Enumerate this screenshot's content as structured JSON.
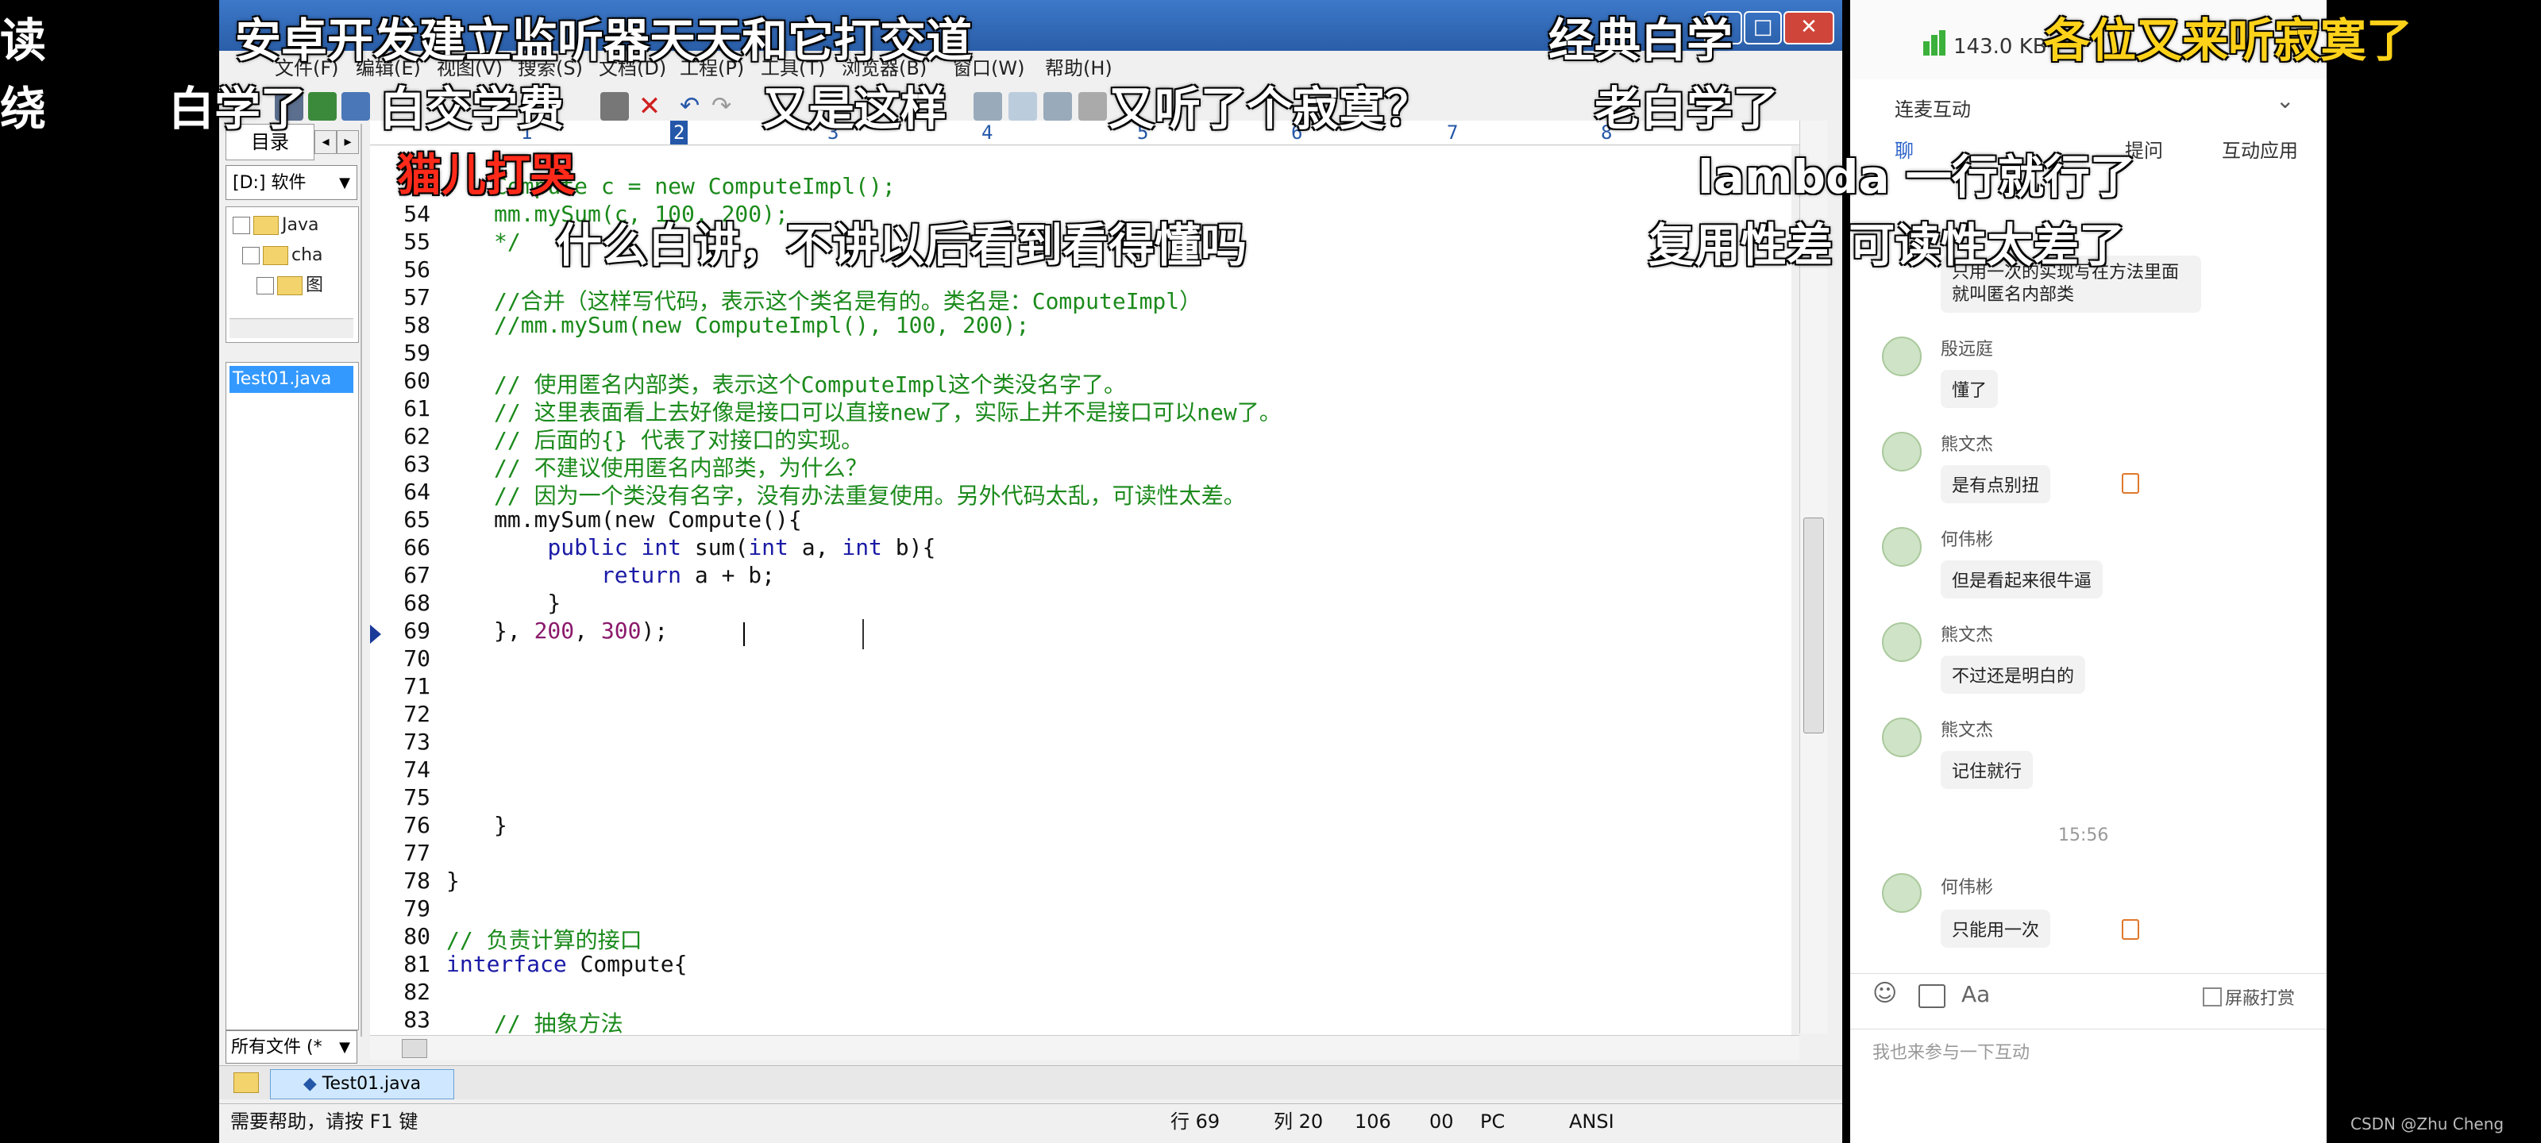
{
  "editor": {
    "menu": [
      "文件(F)",
      "编辑(E)",
      "视图(V)",
      "搜索(S)",
      "文档(D)",
      "工程(P)",
      "工具(T)",
      "浏览器(B)",
      "窗口(W)",
      "帮助(H)"
    ],
    "left_pane": {
      "tab": "目录",
      "drive": "[D:] 软件",
      "tree": [
        "Java",
        "cha",
        "图"
      ],
      "selected_file": "Test01.java",
      "filter": "所有文件 (*"
    },
    "ruler": [
      "1",
      "2",
      "3",
      "4",
      "5",
      "6",
      "7",
      "8"
    ],
    "code_lines": [
      {
        "n": "",
        "t": "Compute c = new ComputeImpl();",
        "c": "cm"
      },
      {
        "n": "54",
        "t": "mm.mySum(c, 100, 200);",
        "c": "cm"
      },
      {
        "n": "55",
        "t": "*/",
        "c": "cm"
      },
      {
        "n": "56",
        "t": "",
        "c": "pl"
      },
      {
        "n": "57",
        "t": "//合并（这样写代码，表示这个类名是有的。类名是：ComputeImpl）",
        "c": "cm"
      },
      {
        "n": "58",
        "t": "//mm.mySum(new ComputeImpl(), 100, 200);",
        "c": "cm"
      },
      {
        "n": "59",
        "t": "",
        "c": "pl"
      },
      {
        "n": "60",
        "t": "// 使用匿名内部类，表示这个ComputeImpl这个类没名字了。",
        "c": "cm"
      },
      {
        "n": "61",
        "t": "// 这里表面看上去好像是接口可以直接new了，实际上并不是接口可以new了。",
        "c": "cm"
      },
      {
        "n": "62",
        "t": "// 后面的{} 代表了对接口的实现。",
        "c": "cm"
      },
      {
        "n": "63",
        "t": "// 不建议使用匿名内部类，为什么？",
        "c": "cm"
      },
      {
        "n": "64",
        "t": "// 因为一个类没有名字，没有办法重复使用。另外代码太乱，可读性太差。",
        "c": "cm"
      },
      {
        "n": "65",
        "t": "mm.mySum(new Compute(){",
        "c": "pl"
      },
      {
        "n": "66",
        "t": "    public int sum(int a, int b){",
        "c": "kwline"
      },
      {
        "n": "67",
        "t": "        return a + b;",
        "c": "retline"
      },
      {
        "n": "68",
        "t": "    }",
        "c": "pl"
      },
      {
        "n": "69",
        "t": "}, 200, 300);",
        "c": "numline"
      },
      {
        "n": "70",
        "t": "",
        "c": "pl"
      },
      {
        "n": "71",
        "t": "",
        "c": "pl"
      },
      {
        "n": "72",
        "t": "",
        "c": "pl"
      },
      {
        "n": "73",
        "t": "",
        "c": "pl"
      },
      {
        "n": "74",
        "t": "",
        "c": "pl"
      },
      {
        "n": "75",
        "t": "",
        "c": "pl"
      },
      {
        "n": "76",
        "t": "}",
        "c": "pl"
      },
      {
        "n": "77",
        "t": "",
        "c": "pl"
      },
      {
        "n": "78",
        "t": "}",
        "c": "pl"
      },
      {
        "n": "79",
        "t": "",
        "c": "pl"
      },
      {
        "n": "80",
        "t": "// 负责计算的接口",
        "c": "cm"
      },
      {
        "n": "81",
        "t": "interface Compute{",
        "c": "ifline"
      },
      {
        "n": "82",
        "t": "",
        "c": "pl"
      },
      {
        "n": "83",
        "t": "// 抽象方法",
        "c": "cm"
      }
    ],
    "file_tab": "Test01.java",
    "status": {
      "help": "需要帮助，请按 F1 键",
      "line": "行 69",
      "col": "列 20",
      "chars": "106",
      "code": "00",
      "mode": "PC",
      "encoding": "ANSI"
    }
  },
  "chat": {
    "signal": "143.0 KB",
    "section_title": "连麦互动",
    "tabs": [
      "聊",
      "提问",
      "互动应用"
    ],
    "messages": [
      {
        "name": "",
        "text": "只用一次的实现写在方法里面就叫匿名内部类"
      },
      {
        "name": "殷远庭",
        "text": "懂了"
      },
      {
        "name": "熊文杰",
        "text": "是有点别扭"
      },
      {
        "name": "何伟彬",
        "text": "但是看起来很牛逼"
      },
      {
        "name": "熊文杰",
        "text": "不过还是明白的"
      },
      {
        "name": "熊文杰",
        "text": "记住就行"
      },
      {
        "name": "何伟彬",
        "text": "只能用一次"
      }
    ],
    "time": "15:56",
    "shield_label": "屏蔽打赏",
    "input_placeholder": "我也来参与一下互动"
  },
  "danmaku": [
    "安卓开发建立监听器天天和它打交道",
    "经典白学",
    "各位又来听寂寞了",
    "白学了",
    "白交学费",
    "又是这样",
    "又听了个寂寞？",
    "老白学了",
    "猫儿打哭",
    "lambda 一行就行了",
    "什么白讲，不讲以后看到看得懂吗",
    "复用性差  可读性太差了",
    "读",
    "绕"
  ],
  "watermark": "CSDN @Zhu Cheng",
  "colors": {
    "comment": "#1b8a1b",
    "keyword": "#1a1aa6",
    "number": "#8b1a6b",
    "title_bar": "#2a5ea8"
  }
}
